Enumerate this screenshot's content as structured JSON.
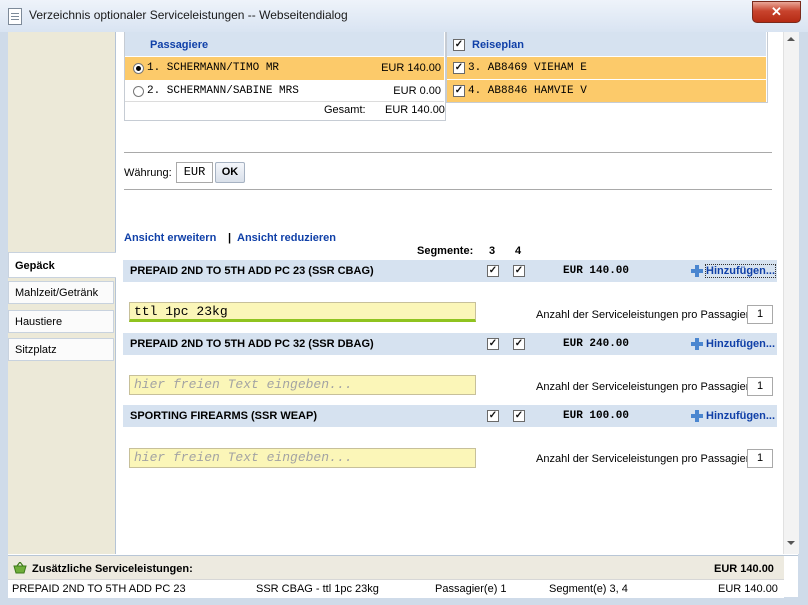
{
  "window": {
    "title": "Verzeichnis optionaler Serviceleistungen -- Webseitendialog",
    "close_label": "✕"
  },
  "sidebar": {
    "items": [
      {
        "label": "Gepäck",
        "active": true
      },
      {
        "label": "Mahlzeit/Getränk",
        "active": false
      },
      {
        "label": "Haustiere",
        "active": false
      },
      {
        "label": "Sitzplatz",
        "active": false
      }
    ]
  },
  "passengers": {
    "header": "Passagiere",
    "rows": [
      {
        "name": "1. SCHERMANN/TIMO MR",
        "amount": "EUR 140.00",
        "selected": true
      },
      {
        "name": "2. SCHERMANN/SABINE MRS",
        "amount": "EUR 0.00",
        "selected": false
      }
    ],
    "total_label": "Gesamt:",
    "total_value": "EUR 140.00"
  },
  "itinerary": {
    "header": "Reiseplan",
    "checked": true,
    "rows": [
      {
        "label": "3. AB8469 VIEHAM E",
        "checked": true
      },
      {
        "label": "4. AB8846 HAMVIE V",
        "checked": true
      }
    ]
  },
  "currency": {
    "label": "Währung:",
    "value": "EUR",
    "ok_label": "OK"
  },
  "view": {
    "expand": "Ansicht erweitern",
    "separator": "|",
    "reduce": "Ansicht reduzieren"
  },
  "segments": {
    "label": "Segmente:",
    "numbers": [
      "3",
      "4"
    ]
  },
  "services": [
    {
      "title": "PREPAID 2ND TO 5TH ADD PC 23 (SSR CBAG)",
      "seg3": true,
      "seg4": true,
      "price": "EUR 140.00",
      "add_label": "Hinzufügen...",
      "text_value": "ttl 1pc 23kg",
      "placeholder": "hier freien Text eingeben...",
      "count_label": "Anzahl der Serviceleistungen pro Passagier:",
      "count": "1"
    },
    {
      "title": "PREPAID 2ND TO 5TH ADD PC 32 (SSR DBAG)",
      "seg3": true,
      "seg4": true,
      "price": "EUR 240.00",
      "add_label": "Hinzufügen...",
      "text_value": "",
      "placeholder": "hier freien Text eingeben...",
      "count_label": "Anzahl der Serviceleistungen pro Passagier:",
      "count": "1"
    },
    {
      "title": "SPORTING FIREARMS (SSR WEAP)",
      "seg3": true,
      "seg4": true,
      "price": "EUR 100.00",
      "add_label": "Hinzufügen...",
      "text_value": "",
      "placeholder": "hier freien Text eingeben...",
      "count_label": "Anzahl der Serviceleistungen pro Passagier:",
      "count": "1"
    }
  ],
  "summary": {
    "title": "Zusätzliche Serviceleistungen:",
    "total": "EUR 140.00",
    "row": {
      "service": "PREPAID 2ND TO 5TH ADD PC 23",
      "code": "SSR CBAG - ttl 1pc 23kg",
      "passengers": "Passagier(e) 1",
      "segments": "Segment(e) 3, 4",
      "amount": "EUR 140.00"
    }
  },
  "colors": {
    "accent_blue": "#1040a8",
    "header_bg": "#d6e2f0",
    "selected_row": "#fcca6a",
    "input_bg": "#fbf6b8",
    "sidebar_bg": "#ece9d8"
  }
}
